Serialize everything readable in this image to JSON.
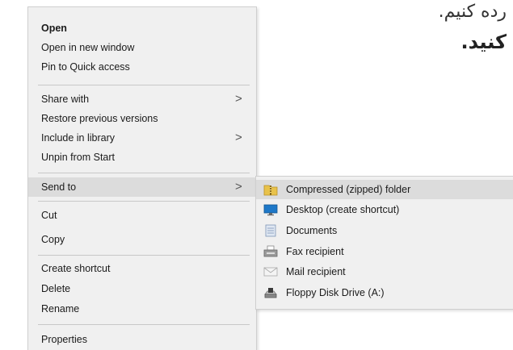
{
  "background_text": {
    "line1": "رده کنیم.",
    "line2": "کنید."
  },
  "context_menu": {
    "items": [
      {
        "label": "Open"
      },
      {
        "label": "Open in new window"
      },
      {
        "label": "Pin to Quick access"
      },
      {
        "label": "Share with",
        "submenu_arrow": ">"
      },
      {
        "label": "Restore previous versions"
      },
      {
        "label": "Include in library",
        "submenu_arrow": ">"
      },
      {
        "label": "Unpin from Start"
      },
      {
        "label": "Send to",
        "submenu_arrow": ">"
      },
      {
        "label": "Cut"
      },
      {
        "label": "Copy"
      },
      {
        "label": "Create shortcut"
      },
      {
        "label": "Delete"
      },
      {
        "label": "Rename"
      },
      {
        "label": "Properties"
      }
    ],
    "highlighted": "Send to"
  },
  "send_to_submenu": {
    "items": [
      {
        "label": "Compressed (zipped) folder",
        "icon": "zip-folder-icon"
      },
      {
        "label": "Desktop (create shortcut)",
        "icon": "desktop-icon"
      },
      {
        "label": "Documents",
        "icon": "documents-icon"
      },
      {
        "label": "Fax recipient",
        "icon": "fax-icon"
      },
      {
        "label": "Mail recipient",
        "icon": "mail-icon"
      },
      {
        "label": "Floppy Disk Drive (A:)",
        "icon": "floppy-drive-icon"
      }
    ],
    "highlighted": "Compressed (zipped) folder"
  },
  "colors": {
    "menu_background": "#f0f0f0",
    "highlight": "#dcdcdc",
    "separator": "#c8c8c8"
  }
}
